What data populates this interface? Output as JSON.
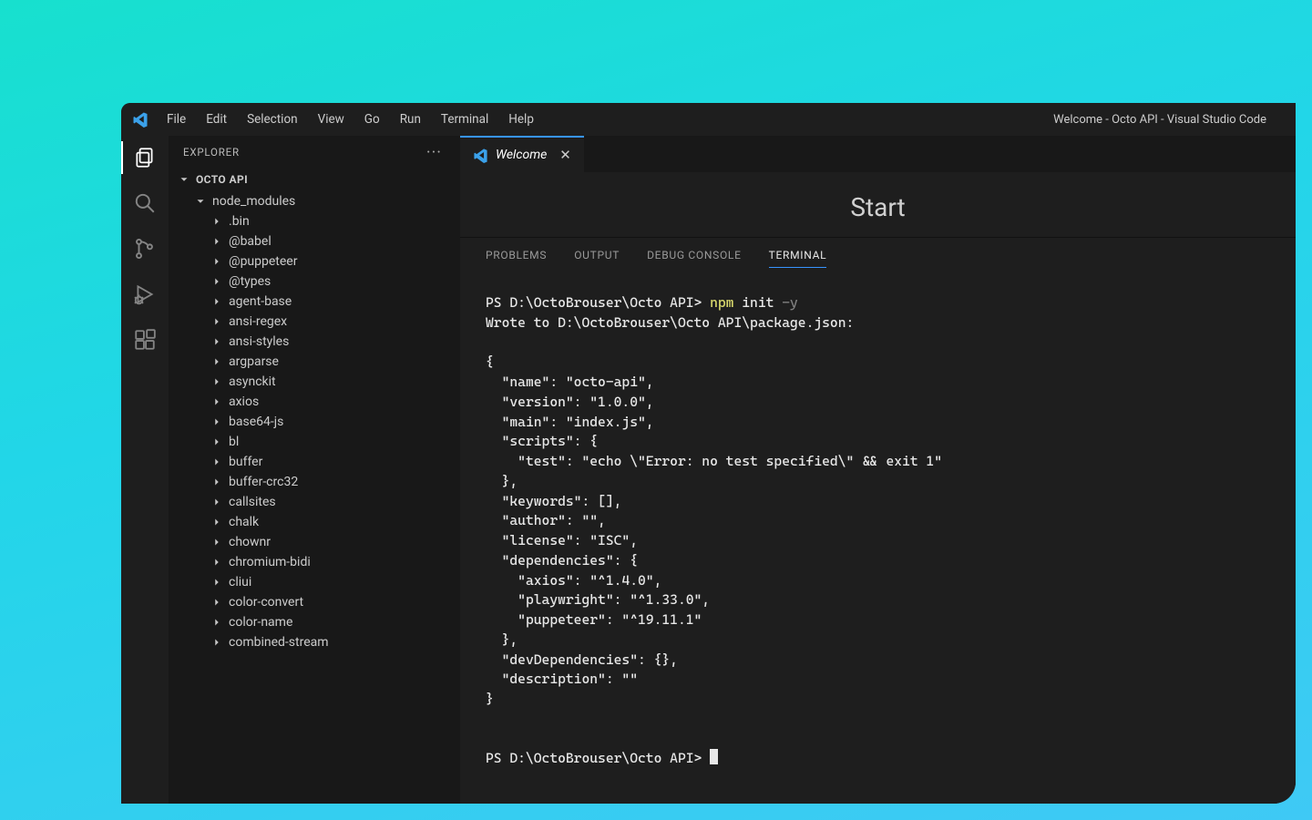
{
  "window": {
    "title": "Welcome - Octo API - Visual Studio Code"
  },
  "menu": [
    "File",
    "Edit",
    "Selection",
    "View",
    "Go",
    "Run",
    "Terminal",
    "Help"
  ],
  "sidebar": {
    "title": "EXPLORER",
    "root": "OCTO API",
    "folder": "node_modules",
    "items": [
      ".bin",
      "@babel",
      "@puppeteer",
      "@types",
      "agent-base",
      "ansi-regex",
      "ansi-styles",
      "argparse",
      "asynckit",
      "axios",
      "base64-js",
      "bl",
      "buffer",
      "buffer-crc32",
      "callsites",
      "chalk",
      "chownr",
      "chromium-bidi",
      "cliui",
      "color-convert",
      "color-name",
      "combined-stream"
    ]
  },
  "editor": {
    "tab": "Welcome",
    "start": "Start"
  },
  "panel": {
    "tabs": [
      "PROBLEMS",
      "OUTPUT",
      "DEBUG CONSOLE",
      "TERMINAL"
    ],
    "active": 3
  },
  "terminal": {
    "prompt1": "PS D:\\OctoBrouser\\Octo API> ",
    "cmd": "npm",
    "args": " init ",
    "flag": "-y",
    "line2": "Wrote to D:\\OctoBrouser\\Octo API\\package.json:",
    "json": "{\n  \"name\": \"octo-api\",\n  \"version\": \"1.0.0\",\n  \"main\": \"index.js\",\n  \"scripts\": {\n    \"test\": \"echo \\\"Error: no test specified\\\" && exit 1\"\n  },\n  \"keywords\": [],\n  \"author\": \"\",\n  \"license\": \"ISC\",\n  \"dependencies\": {\n    \"axios\": \"^1.4.0\",\n    \"playwright\": \"^1.33.0\",\n    \"puppeteer\": \"^19.11.1\"\n  },\n  \"devDependencies\": {},\n  \"description\": \"\"\n}",
    "prompt2": "PS D:\\OctoBrouser\\Octo API> "
  }
}
